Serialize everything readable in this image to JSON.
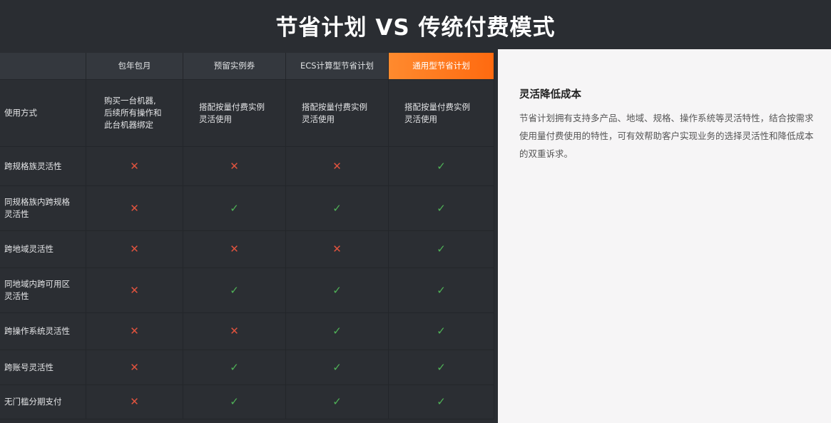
{
  "title": "节省计划 VS 传统付费模式",
  "table": {
    "headers": [
      "",
      "包年包月",
      "预留实例券",
      "ECS计算型节省计划",
      "通用型节省计划"
    ],
    "usage_row": {
      "label": "使用方式",
      "cells": [
        [
          "购买一台机器,",
          "后续所有操作和",
          "此台机器绑定"
        ],
        [
          "搭配按量付费实例",
          "灵活使用"
        ],
        [
          "搭配按量付费实例",
          "灵活使用"
        ],
        [
          "搭配按量付费实例",
          "灵活使用"
        ]
      ]
    },
    "rows": [
      {
        "label": [
          "跨规格族灵活性"
        ],
        "marks": [
          "cross",
          "cross",
          "cross",
          "check"
        ]
      },
      {
        "label": [
          "同规格族内跨规格",
          "灵活性"
        ],
        "marks": [
          "cross",
          "check",
          "check",
          "check"
        ]
      },
      {
        "label": [
          "跨地域灵活性"
        ],
        "marks": [
          "cross",
          "cross",
          "cross",
          "check"
        ]
      },
      {
        "label": [
          "同地域内跨可用区",
          "灵活性"
        ],
        "marks": [
          "cross",
          "check",
          "check",
          "check"
        ]
      },
      {
        "label": [
          "跨操作系统灵活性"
        ],
        "marks": [
          "cross",
          "cross",
          "check",
          "check"
        ]
      },
      {
        "label": [
          "跨账号灵活性"
        ],
        "marks": [
          "cross",
          "check",
          "check",
          "check"
        ]
      },
      {
        "label": [
          "无门槛分期支付"
        ],
        "marks": [
          "cross",
          "check",
          "check",
          "check"
        ]
      }
    ],
    "icons": {
      "cross": "✕",
      "check": "✓"
    }
  },
  "panel": {
    "title": "灵活降低成本",
    "desc": "节省计划拥有支持多产品、地域、规格、操作系统等灵活特性，结合按需求使用量付费使用的特性，可有效帮助客户实现业务的选择灵活性和降低成本的双重诉求。"
  }
}
